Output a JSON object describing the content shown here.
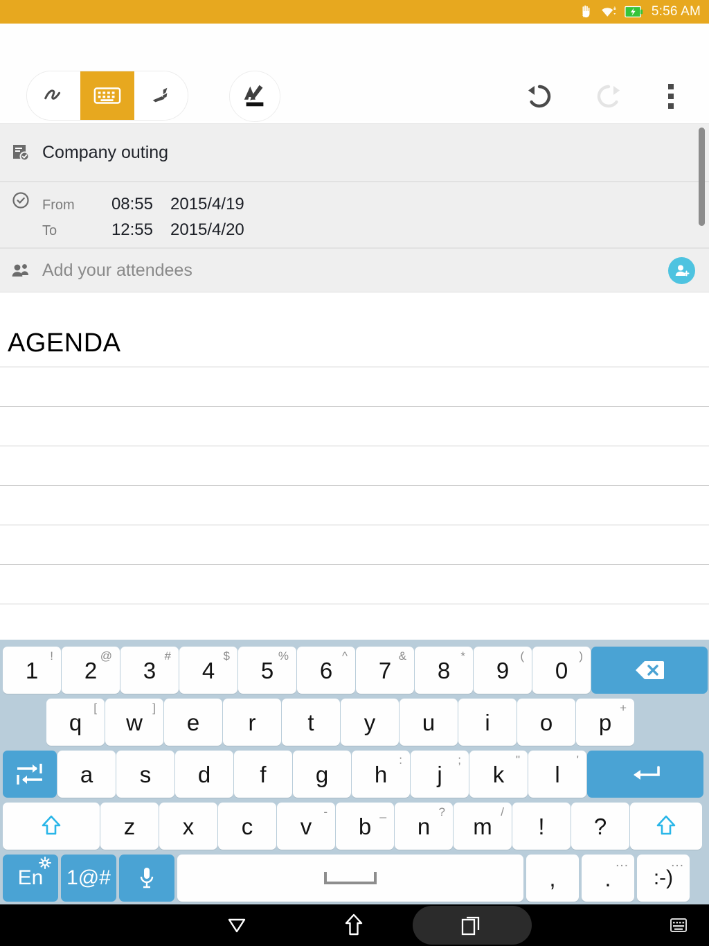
{
  "status_bar": {
    "time": "5:56 AM",
    "icons": [
      "hand-star-icon",
      "wifi-icon",
      "battery-charging-icon"
    ],
    "background_color": "#e7a81f"
  },
  "toolbar": {
    "mode_segments": [
      {
        "name": "scribble-mode",
        "label": "",
        "icon": "scribble-icon",
        "active": false
      },
      {
        "name": "keyboard-mode",
        "label": "",
        "icon": "keyboard-icon",
        "active": true
      },
      {
        "name": "marker-mode",
        "label": "",
        "icon": "marker-icon",
        "active": false
      }
    ],
    "pen_tool": {
      "name": "pen-eraser-tool",
      "icon": "pen-highlighter-icon"
    },
    "undo": {
      "label": "",
      "icon": "undo-icon",
      "enabled": true
    },
    "redo": {
      "label": "",
      "icon": "redo-icon",
      "enabled": false
    },
    "overflow": {
      "label": "",
      "icon": "more-vertical-icon"
    },
    "accent_color": "#e7a81f"
  },
  "note": {
    "title": "Company outing",
    "title_icon": "note-check-icon",
    "time_icon": "clock-check-icon",
    "schedule": [
      {
        "label": "From",
        "time": "08:55",
        "date": "2015/4/19"
      },
      {
        "label": "To",
        "time": "12:55",
        "date": "2015/4/20"
      }
    ],
    "attendees": {
      "icon": "people-group-icon",
      "placeholder": "Add your attendees",
      "add_button_icon": "add-person-icon",
      "add_button_color": "#4ec3e0"
    },
    "body_text": "AGENDA",
    "rule_line_color": "#cfcfcf"
  },
  "keyboard": {
    "background_color": "#b9cdda",
    "key_color": "#fefefe",
    "special_key_color": "#4aa3d4",
    "row_numbers": [
      {
        "main": "1",
        "sup": "!"
      },
      {
        "main": "2",
        "sup": "@"
      },
      {
        "main": "3",
        "sup": "#"
      },
      {
        "main": "4",
        "sup": "$"
      },
      {
        "main": "5",
        "sup": "%"
      },
      {
        "main": "6",
        "sup": "^"
      },
      {
        "main": "7",
        "sup": "&"
      },
      {
        "main": "8",
        "sup": "*"
      },
      {
        "main": "9",
        "sup": "("
      },
      {
        "main": "0",
        "sup": ")"
      }
    ],
    "backspace": {
      "name": "backspace-key",
      "icon": "backspace-icon"
    },
    "row_top": [
      {
        "main": "q",
        "sup": "["
      },
      {
        "main": "w",
        "sup": "]"
      },
      {
        "main": "e",
        "sup": ""
      },
      {
        "main": "r",
        "sup": ""
      },
      {
        "main": "t",
        "sup": ""
      },
      {
        "main": "y",
        "sup": ""
      },
      {
        "main": "u",
        "sup": ""
      },
      {
        "main": "i",
        "sup": ""
      },
      {
        "main": "o",
        "sup": ""
      },
      {
        "main": "p",
        "sup": "+"
      }
    ],
    "tab": {
      "name": "tab-key",
      "icon": "tab-icon"
    },
    "row_home": [
      {
        "main": "a",
        "sup": ""
      },
      {
        "main": "s",
        "sup": ""
      },
      {
        "main": "d",
        "sup": ""
      },
      {
        "main": "f",
        "sup": ""
      },
      {
        "main": "g",
        "sup": ""
      },
      {
        "main": "h",
        "sup": ":"
      },
      {
        "main": "j",
        "sup": ";"
      },
      {
        "main": "k",
        "sup": "\""
      },
      {
        "main": "l",
        "sup": "'"
      }
    ],
    "enter": {
      "name": "enter-key",
      "icon": "enter-icon"
    },
    "shift_left": {
      "name": "shift-left-key",
      "icon": "shift-icon"
    },
    "row_bottom": [
      {
        "main": "z",
        "sup": ""
      },
      {
        "main": "x",
        "sup": ""
      },
      {
        "main": "c",
        "sup": ""
      },
      {
        "main": "v",
        "sup": "-"
      },
      {
        "main": "b",
        "sup": "_"
      },
      {
        "main": "n",
        "sup": "?"
      },
      {
        "main": "m",
        "sup": "/"
      },
      {
        "main": "!",
        "sup": ""
      },
      {
        "main": "?",
        "sup": ""
      }
    ],
    "shift_right": {
      "name": "shift-right-key",
      "icon": "shift-icon"
    },
    "language": {
      "main": "En",
      "name": "language-key",
      "icon": "gear-icon"
    },
    "symbols": {
      "main": "1@#",
      "name": "symbols-key"
    },
    "mic": {
      "name": "voice-input-key",
      "icon": "microphone-icon"
    },
    "space": {
      "name": "space-key",
      "icon": "space-bracket-icon"
    },
    "comma": {
      "main": ",",
      "sup": ""
    },
    "period": {
      "main": ".",
      "sup": "..."
    },
    "emoji": {
      "main": ":-)",
      "sup": "..."
    }
  },
  "navbar": {
    "background_color": "#000000",
    "back": {
      "name": "nav-back-button",
      "icon": "back-triangle-icon"
    },
    "home": {
      "name": "nav-home-button",
      "icon": "home-arrow-icon"
    },
    "recents": {
      "name": "nav-recents-button",
      "icon": "recents-icon",
      "highlighted": true
    },
    "keyboard_toggle": {
      "name": "nav-keyboard-button",
      "icon": "keyboard-small-icon"
    }
  }
}
